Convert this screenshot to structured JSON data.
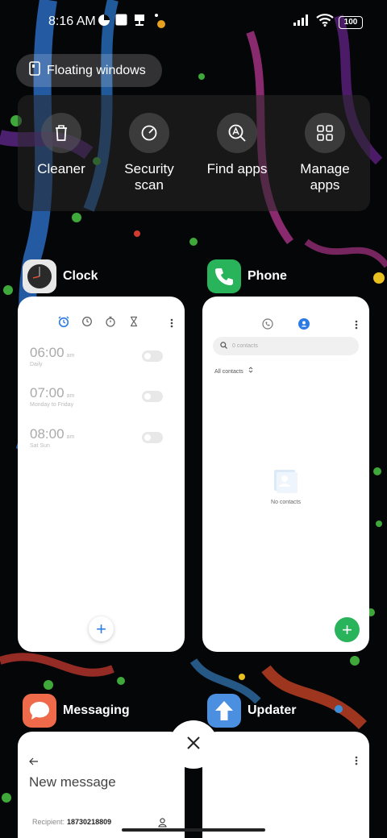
{
  "status_bar": {
    "time": "8:16 AM",
    "notification_icons": [
      "app-notification-icon",
      "square-notification-icon",
      "download-notification-icon"
    ],
    "battery": "100",
    "signal_icon": "cellular-signal-icon",
    "wifi_icon": "wifi-icon"
  },
  "floating_windows": {
    "label": "Floating windows",
    "icon": "floating-window-icon"
  },
  "quick_actions": [
    {
      "label": "Cleaner",
      "icon": "trash-icon"
    },
    {
      "label": "Security\nscan",
      "icon": "security-scan-icon"
    },
    {
      "label": "Find apps",
      "icon": "find-apps-icon"
    },
    {
      "label": "Manage\napps",
      "icon": "grid-icon"
    }
  ],
  "apps": {
    "clock": {
      "name": "Clock",
      "icon": "clock-app-icon",
      "tabs": [
        "alarm-icon",
        "world-clock-icon",
        "stopwatch-icon",
        "timer-icon"
      ],
      "alarms": [
        {
          "time": "06:00",
          "ampm": "am",
          "repeat": "Daily",
          "enabled": false
        },
        {
          "time": "07:00",
          "ampm": "am",
          "repeat": "Monday to Friday",
          "enabled": false
        },
        {
          "time": "08:00",
          "ampm": "am",
          "repeat": "Sat Sun",
          "enabled": false
        }
      ],
      "add_label": "+"
    },
    "phone": {
      "name": "Phone",
      "icon": "phone-app-icon",
      "search_placeholder": "0 contacts",
      "filter_label": "All contacts",
      "empty_label": "No contacts",
      "add_label": "+"
    },
    "messaging": {
      "name": "Messaging",
      "icon": "messaging-app-icon",
      "title": "New message",
      "recipient_label": "Recipient:",
      "recipient_value": "18730218809"
    },
    "updater": {
      "name": "Updater",
      "icon": "updater-app-icon"
    }
  },
  "colors": {
    "accent_blue": "#2c7be5",
    "phone_green": "#29b35a",
    "messaging_orange": "#ef6a4a",
    "updater_blue": "#4a8fe0"
  }
}
